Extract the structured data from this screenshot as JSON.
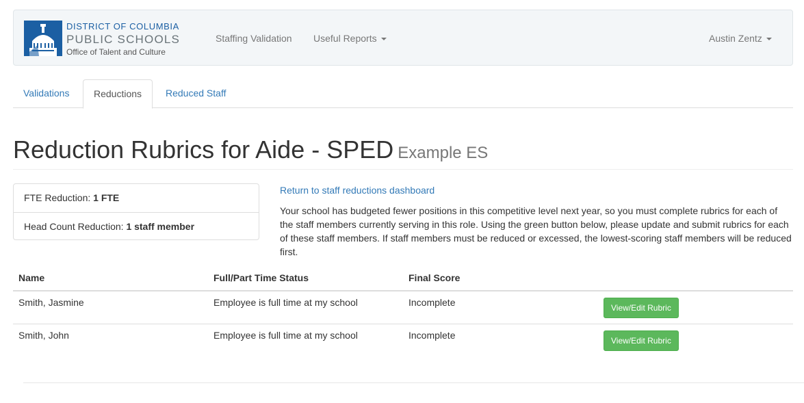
{
  "header": {
    "logo_line1": "DISTRICT OF COLUMBIA",
    "logo_line2": "PUBLIC SCHOOLS",
    "logo_line3": "Office of Talent and Culture",
    "nav": {
      "staffing_validation": "Staffing Validation",
      "useful_reports": "Useful Reports"
    },
    "user_menu": "Austin Zentz"
  },
  "tabs": [
    {
      "label": "Validations",
      "active": false
    },
    {
      "label": "Reductions",
      "active": true
    },
    {
      "label": "Reduced Staff",
      "active": false
    }
  ],
  "page": {
    "title": "Reduction Rubrics for Aide - SPED",
    "subtitle": "Example ES"
  },
  "summary": {
    "fte_label": "FTE Reduction:",
    "fte_value": "1 FTE",
    "headcount_label": "Head Count Reduction:",
    "headcount_value": "1 staff member"
  },
  "return_link": "Return to staff reductions dashboard",
  "description": "Your school has budgeted fewer positions in this competitive level next year, so you must complete rubrics for each of the staff members currently serving in this role. Using the green button below, please update and submit rubrics for each of these staff members. If staff members must be reduced or excessed, the lowest-scoring staff members will be reduced first.",
  "table": {
    "headers": [
      "Name",
      "Full/Part Time Status",
      "Final Score",
      ""
    ],
    "rows": [
      {
        "name": "Smith, Jasmine",
        "status": "Employee is full time at my school",
        "score": "Incomplete",
        "action": "View/Edit Rubric"
      },
      {
        "name": "Smith, John",
        "status": "Employee is full time at my school",
        "score": "Incomplete",
        "action": "View/Edit Rubric"
      }
    ]
  },
  "colors": {
    "link": "#337ab7",
    "brand_blue": "#1b5fa3",
    "button_green": "#5cb85c"
  }
}
